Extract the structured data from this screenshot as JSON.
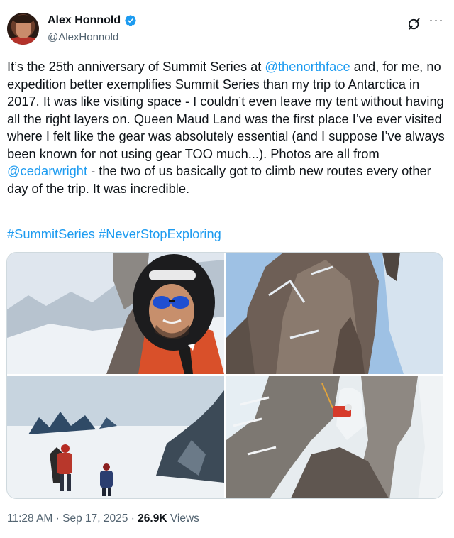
{
  "author": {
    "name": "Alex Honnold",
    "handle": "@AlexHonnold"
  },
  "tweet": {
    "text_parts": {
      "p1": "It’s the 25th anniversary of Summit Series at ",
      "mention1": "@thenorthface",
      "p2": " and, for me, no expedition better exemplifies Summit Series than my trip to Antarctica in 2017. It was like visiting space - I couldn’t even leave my tent without having all the right layers on. Queen Maud Land was the first place I’ve ever visited where I felt like the gear was absolutely essential (and I suppose I’ve always been known for not using gear TOO much...). Photos are all from ",
      "mention2": "@cedarwright",
      "p3": " - the two of us basically got to climb new routes every other day of the trip. It was incredible."
    },
    "hashtags": [
      "#SummitSeries",
      "#NeverStopExploring"
    ],
    "photos": [
      "Selfie of climber in helmet-hood and blue sunglasses with snowy peaks",
      "Granite rock spire with climber on ridge",
      "Two climbers on snowfield with jagged peaks",
      "Climber in red jacket inside rock arch"
    ]
  },
  "meta": {
    "time": "11:28 AM",
    "separator": "·",
    "date": "Sep 17, 2025",
    "views_count": "26.9K",
    "views_label": "Views"
  },
  "colors": {
    "link": "#1d9bf0",
    "secondary_text": "#536471",
    "verified": "#1d9bf0"
  },
  "icons": {
    "verified": "verified-badge-icon",
    "grok": "grok-icon",
    "more": "more-icon"
  }
}
